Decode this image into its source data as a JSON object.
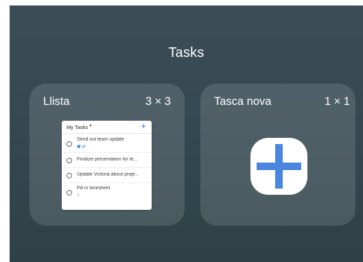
{
  "header": {
    "title": "Tasks"
  },
  "widgets": [
    {
      "name": "Llista",
      "size": "3 × 3",
      "preview": {
        "list_name": "My Tasks",
        "dropdown_icon": "caret-down-icon",
        "add_icon": "plus-icon",
        "tasks": [
          {
            "text": "Send out team update",
            "meta_icons": [
              "calendar-icon",
              "repeat-icon"
            ]
          },
          {
            "text": "Finalize presentation for te..."
          },
          {
            "text": "Update Victoria about proje..."
          },
          {
            "text": "Fill in timesheet",
            "meta_icons": [
              "notes-icon"
            ]
          }
        ]
      }
    },
    {
      "name": "Tasca nova",
      "size": "1 × 1",
      "icon": "new-task-plus-icon"
    }
  ],
  "colors": {
    "background_top": "#3b4d57",
    "background_bottom": "#2e4146",
    "accent_blue": "#4a86e0",
    "preview_blue": "#1a73e8"
  }
}
